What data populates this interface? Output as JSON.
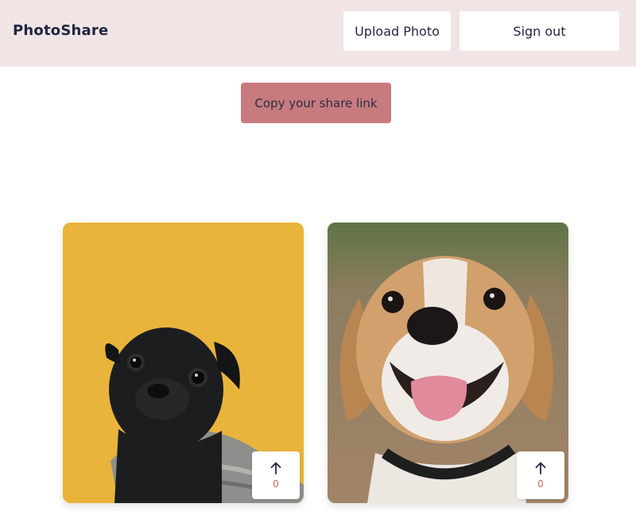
{
  "header": {
    "brand": "PhotoShare",
    "upload_label": "Upload Photo",
    "signout_label": "Sign out"
  },
  "share": {
    "label": "Copy your share link"
  },
  "photos": [
    {
      "image": "pug-photo",
      "upvotes": "0"
    },
    {
      "image": "beagle-photo",
      "upvotes": "0"
    }
  ],
  "colors": {
    "header_bg": "#f1e4e4",
    "share_button_bg": "#c77b7e",
    "text_dark": "#1f2640",
    "count_red": "#c26a6a"
  }
}
